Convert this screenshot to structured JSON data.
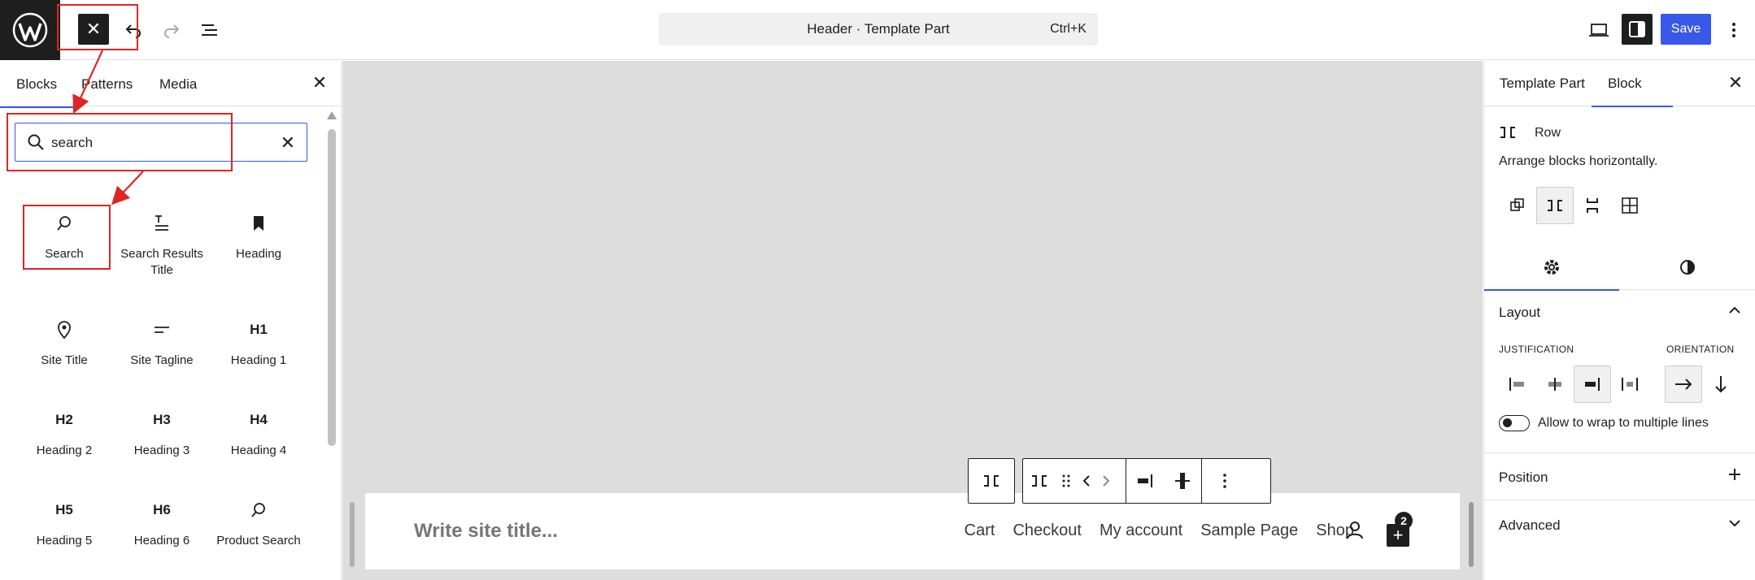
{
  "topbar": {
    "command_title": "Header · Template Part",
    "command_shortcut": "Ctrl+K",
    "save_label": "Save"
  },
  "inserter": {
    "tabs": [
      "Blocks",
      "Patterns",
      "Media"
    ],
    "search_value": "search",
    "blocks": [
      {
        "label": "Search",
        "icon": "search-icon"
      },
      {
        "label": "Search Results Title",
        "icon": "title-icon"
      },
      {
        "label": "Heading",
        "icon": "bookmark-icon"
      },
      {
        "label": "Site Title",
        "icon": "map-pin-icon"
      },
      {
        "label": "Site Tagline",
        "icon": "tagline-icon"
      },
      {
        "label": "Heading 1",
        "icon": "H1"
      },
      {
        "label": "Heading 2",
        "icon": "H2"
      },
      {
        "label": "Heading 3",
        "icon": "H3"
      },
      {
        "label": "Heading 4",
        "icon": "H4"
      },
      {
        "label": "Heading 5",
        "icon": "H5"
      },
      {
        "label": "Heading 6",
        "icon": "H6"
      },
      {
        "label": "Product Search",
        "icon": "search-icon"
      }
    ]
  },
  "canvas": {
    "site_title_placeholder": "Write site title...",
    "nav": [
      "Cart",
      "Checkout",
      "My account",
      "Sample Page",
      "Shop"
    ],
    "cart_count": "2"
  },
  "sidebar": {
    "tabs": [
      "Template Part",
      "Block"
    ],
    "block_name": "Row",
    "block_desc": "Arrange blocks horizontally.",
    "layout_title": "Layout",
    "justification_label": "JUSTIFICATION",
    "orientation_label": "ORIENTATION",
    "wrap_label": "Allow to wrap to multiple lines",
    "position_title": "Position",
    "advanced_title": "Advanced"
  },
  "colors": {
    "accent": "#3858e9",
    "annotation": "#e02424",
    "dark": "#1e1e1e"
  }
}
